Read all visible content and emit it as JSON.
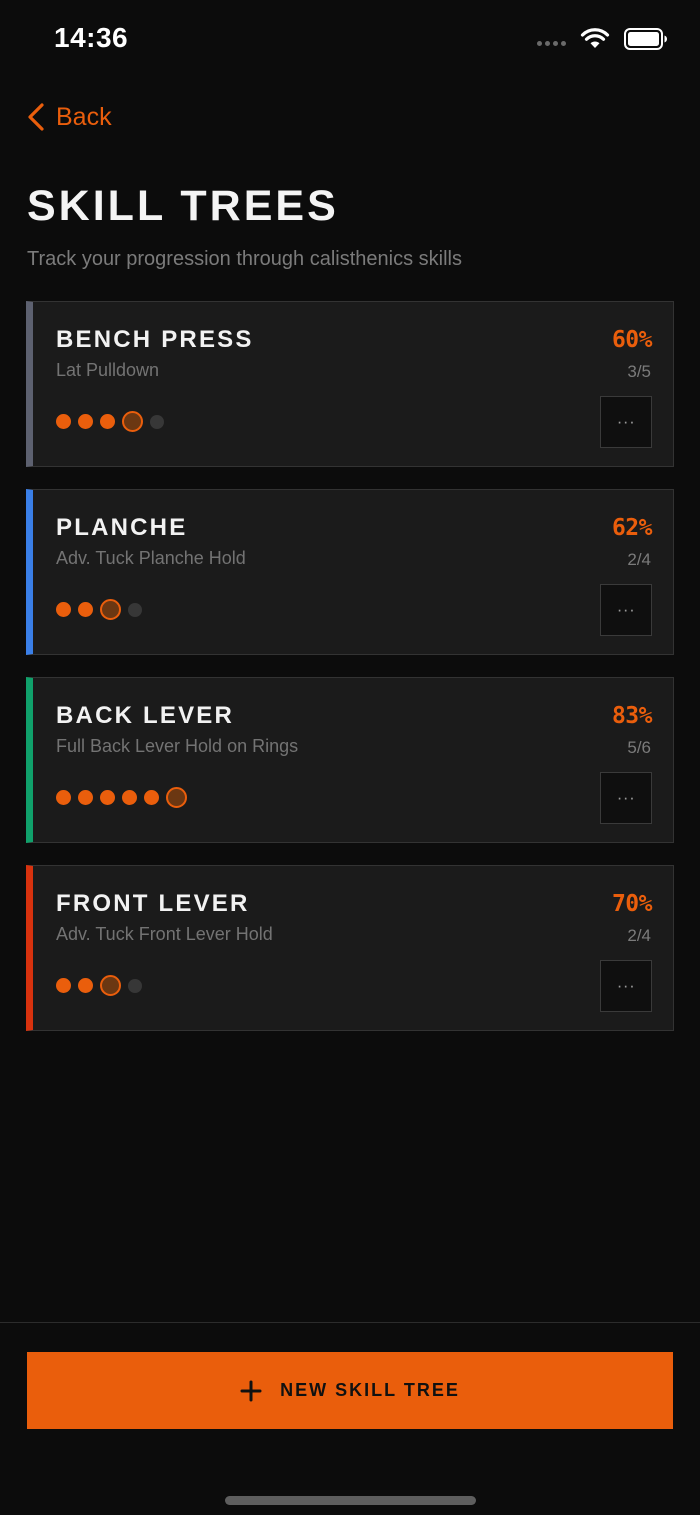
{
  "status_bar": {
    "time": "14:36"
  },
  "nav": {
    "back_label": "Back"
  },
  "header": {
    "title": "SKILL TREES",
    "subtitle": "Track your progression through calisthenics skills"
  },
  "colors": {
    "accent": "#ea5e0c",
    "background": "#0c0c0c",
    "card": "#1b1b1b"
  },
  "skill_trees": [
    {
      "name": "BENCH PRESS",
      "current_step": "Lat Pulldown",
      "percent": "60%",
      "progress": "3/5",
      "stripe_color": "#5d6170",
      "more_label": "···",
      "steps": [
        "done",
        "done",
        "done",
        "current",
        "locked"
      ]
    },
    {
      "name": "PLANCHE",
      "current_step": "Adv. Tuck Planche Hold",
      "percent": "62%",
      "progress": "2/4",
      "stripe_color": "#3a7fe8",
      "more_label": "···",
      "steps": [
        "done",
        "done",
        "current",
        "locked"
      ]
    },
    {
      "name": "BACK LEVER",
      "current_step": "Full Back Lever Hold on Rings",
      "percent": "83%",
      "progress": "5/6",
      "stripe_color": "#10a16b",
      "more_label": "···",
      "steps": [
        "done",
        "done",
        "done",
        "done",
        "done",
        "current"
      ]
    },
    {
      "name": "FRONT LEVER",
      "current_step": "Adv. Tuck Front Lever Hold",
      "percent": "70%",
      "progress": "2/4",
      "stripe_color": "#d8320e",
      "more_label": "···",
      "steps": [
        "done",
        "done",
        "current",
        "locked"
      ]
    }
  ],
  "footer": {
    "new_button_label": "NEW SKILL TREE",
    "new_button_icon": "plus-icon"
  }
}
